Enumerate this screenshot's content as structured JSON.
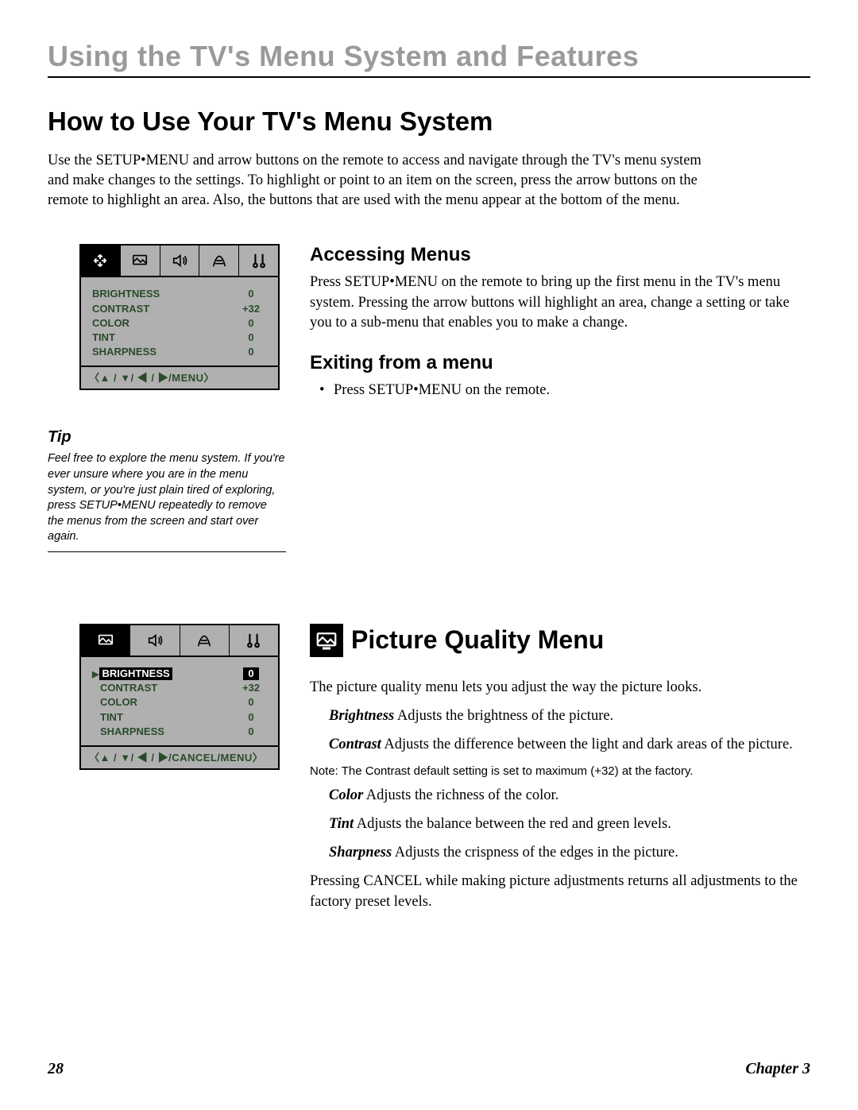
{
  "header": "Using the TV's Menu System and Features",
  "section1": {
    "title": "How to Use Your TV's Menu System",
    "intro": "Use the SETUP•MENU and arrow buttons on the remote to access and navigate through the TV's menu system and make changes to the settings. To highlight or point to an item on the screen, press the arrow buttons on the remote to highlight an area.  Also, the buttons that are used with the menu appear at the bottom of the menu.",
    "accessing": {
      "heading": "Accessing Menus",
      "body": "Press SETUP•MENU on the remote to bring up the first menu in the TV's menu system. Pressing the arrow buttons will highlight an area, change a setting or take you to a sub-menu that enables you to make a change."
    },
    "exiting": {
      "heading": "Exiting from a menu",
      "body": "Press SETUP•MENU on the remote."
    }
  },
  "osd1": {
    "rows": [
      {
        "label": "BRIGHTNESS",
        "value": "0"
      },
      {
        "label": "CONTRAST",
        "value": "+32"
      },
      {
        "label": "COLOR",
        "value": "0"
      },
      {
        "label": "TINT",
        "value": "0"
      },
      {
        "label": "SHARPNESS",
        "value": "0"
      }
    ],
    "footer": "〈▲ / ▼/ ◀ / ▶/MENU〉"
  },
  "tip": {
    "title": "Tip",
    "body": "Feel free to explore the menu system. If you're ever unsure where you are in the menu system, or you're just plain tired of exploring, press SETUP•MENU repeatedly to remove the menus from the screen and start over again."
  },
  "osd2": {
    "rows": [
      {
        "label": "BRIGHTNESS",
        "value": "0",
        "highlight": true
      },
      {
        "label": "CONTRAST",
        "value": "+32"
      },
      {
        "label": "COLOR",
        "value": "0"
      },
      {
        "label": "TINT",
        "value": "0"
      },
      {
        "label": "SHARPNESS",
        "value": "0"
      }
    ],
    "footer": "〈▲ / ▼/ ◀ / ▶/CANCEL/MENU〉"
  },
  "section2": {
    "title": "Picture Quality Menu",
    "intro": "The picture quality menu lets you adjust the way the picture looks.",
    "items": {
      "brightness": {
        "term": "Brightness",
        "desc": "   Adjusts the brightness of the picture."
      },
      "contrast": {
        "term": "Contrast",
        "desc": "    Adjusts the difference between the light and dark areas of the picture."
      },
      "note": "Note:  The Contrast default setting is set to maximum (+32) at the factory.",
      "color": {
        "term": "Color",
        "desc": "    Adjusts the richness of the color."
      },
      "tint": {
        "term": "Tint",
        "desc": "  Adjusts the balance between the red and green levels."
      },
      "sharpness": {
        "term": "Sharpness",
        "desc": "   Adjusts the crispness of the edges in the picture."
      }
    },
    "outro": "Pressing CANCEL while making picture adjustments returns all adjustments to the factory preset levels."
  },
  "footer": {
    "page": "28",
    "chapter": "Chapter 3"
  }
}
